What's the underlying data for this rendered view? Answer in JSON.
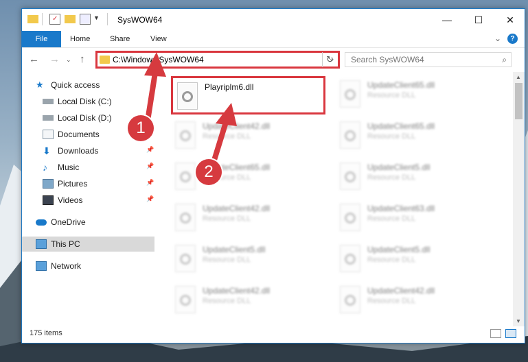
{
  "window": {
    "title": "SysWOW64",
    "controls": {
      "minimize": "—",
      "maximize": "☐",
      "close": "✕"
    }
  },
  "ribbon": {
    "tabs": [
      "File",
      "Home",
      "Share",
      "View"
    ],
    "expand_icon": "chevron-down-icon",
    "help_label": "?"
  },
  "navigation": {
    "address_path": "C:\\Windows\\SysWOW64",
    "search_placeholder": "Search SysWOW64"
  },
  "sidebar": {
    "items": [
      {
        "label": "Quick access",
        "icon": "star-icon"
      },
      {
        "label": "Local Disk (C:)",
        "icon": "drive-icon"
      },
      {
        "label": "Local Disk (D:)",
        "icon": "drive-icon"
      },
      {
        "label": "Documents",
        "icon": "documents-icon"
      },
      {
        "label": "Downloads",
        "icon": "download-icon"
      },
      {
        "label": "Music",
        "icon": "music-icon"
      },
      {
        "label": "Pictures",
        "icon": "pictures-icon"
      },
      {
        "label": "Videos",
        "icon": "videos-icon"
      },
      {
        "label": "OneDrive",
        "icon": "cloud-icon"
      },
      {
        "label": "This PC",
        "icon": "computer-icon"
      },
      {
        "label": "Network",
        "icon": "network-icon"
      }
    ]
  },
  "files": [
    {
      "name": "Playriplm6.dll",
      "type": ""
    },
    {
      "name": "UpdateClient65.dll",
      "type": "Resource DLL"
    },
    {
      "name": "UpdateClient42.dll",
      "type": "Resource DLL"
    },
    {
      "name": "UpdateClient65.dll",
      "type": "Resource DLL"
    },
    {
      "name": "UpdateClient65.dll",
      "type": "Resource DLL"
    },
    {
      "name": "UpdateClient5.dll",
      "type": "Resource DLL"
    },
    {
      "name": "UpdateClient42.dll",
      "type": "Resource DLL"
    },
    {
      "name": "UpdateClient63.dll",
      "type": "Resource DLL"
    },
    {
      "name": "UpdateClient5.dll",
      "type": "Resource DLL"
    },
    {
      "name": "UpdateClient5.dll",
      "type": "Resource DLL"
    },
    {
      "name": "UpdateClient42.dll",
      "type": "Resource DLL"
    },
    {
      "name": "UpdateClient42.dll",
      "type": "Resource DLL"
    }
  ],
  "status": {
    "item_count": "175 items"
  },
  "annotations": {
    "step1": "1",
    "step2": "2"
  },
  "colors": {
    "accent": "#1979ca",
    "highlight": "#d9363e"
  }
}
